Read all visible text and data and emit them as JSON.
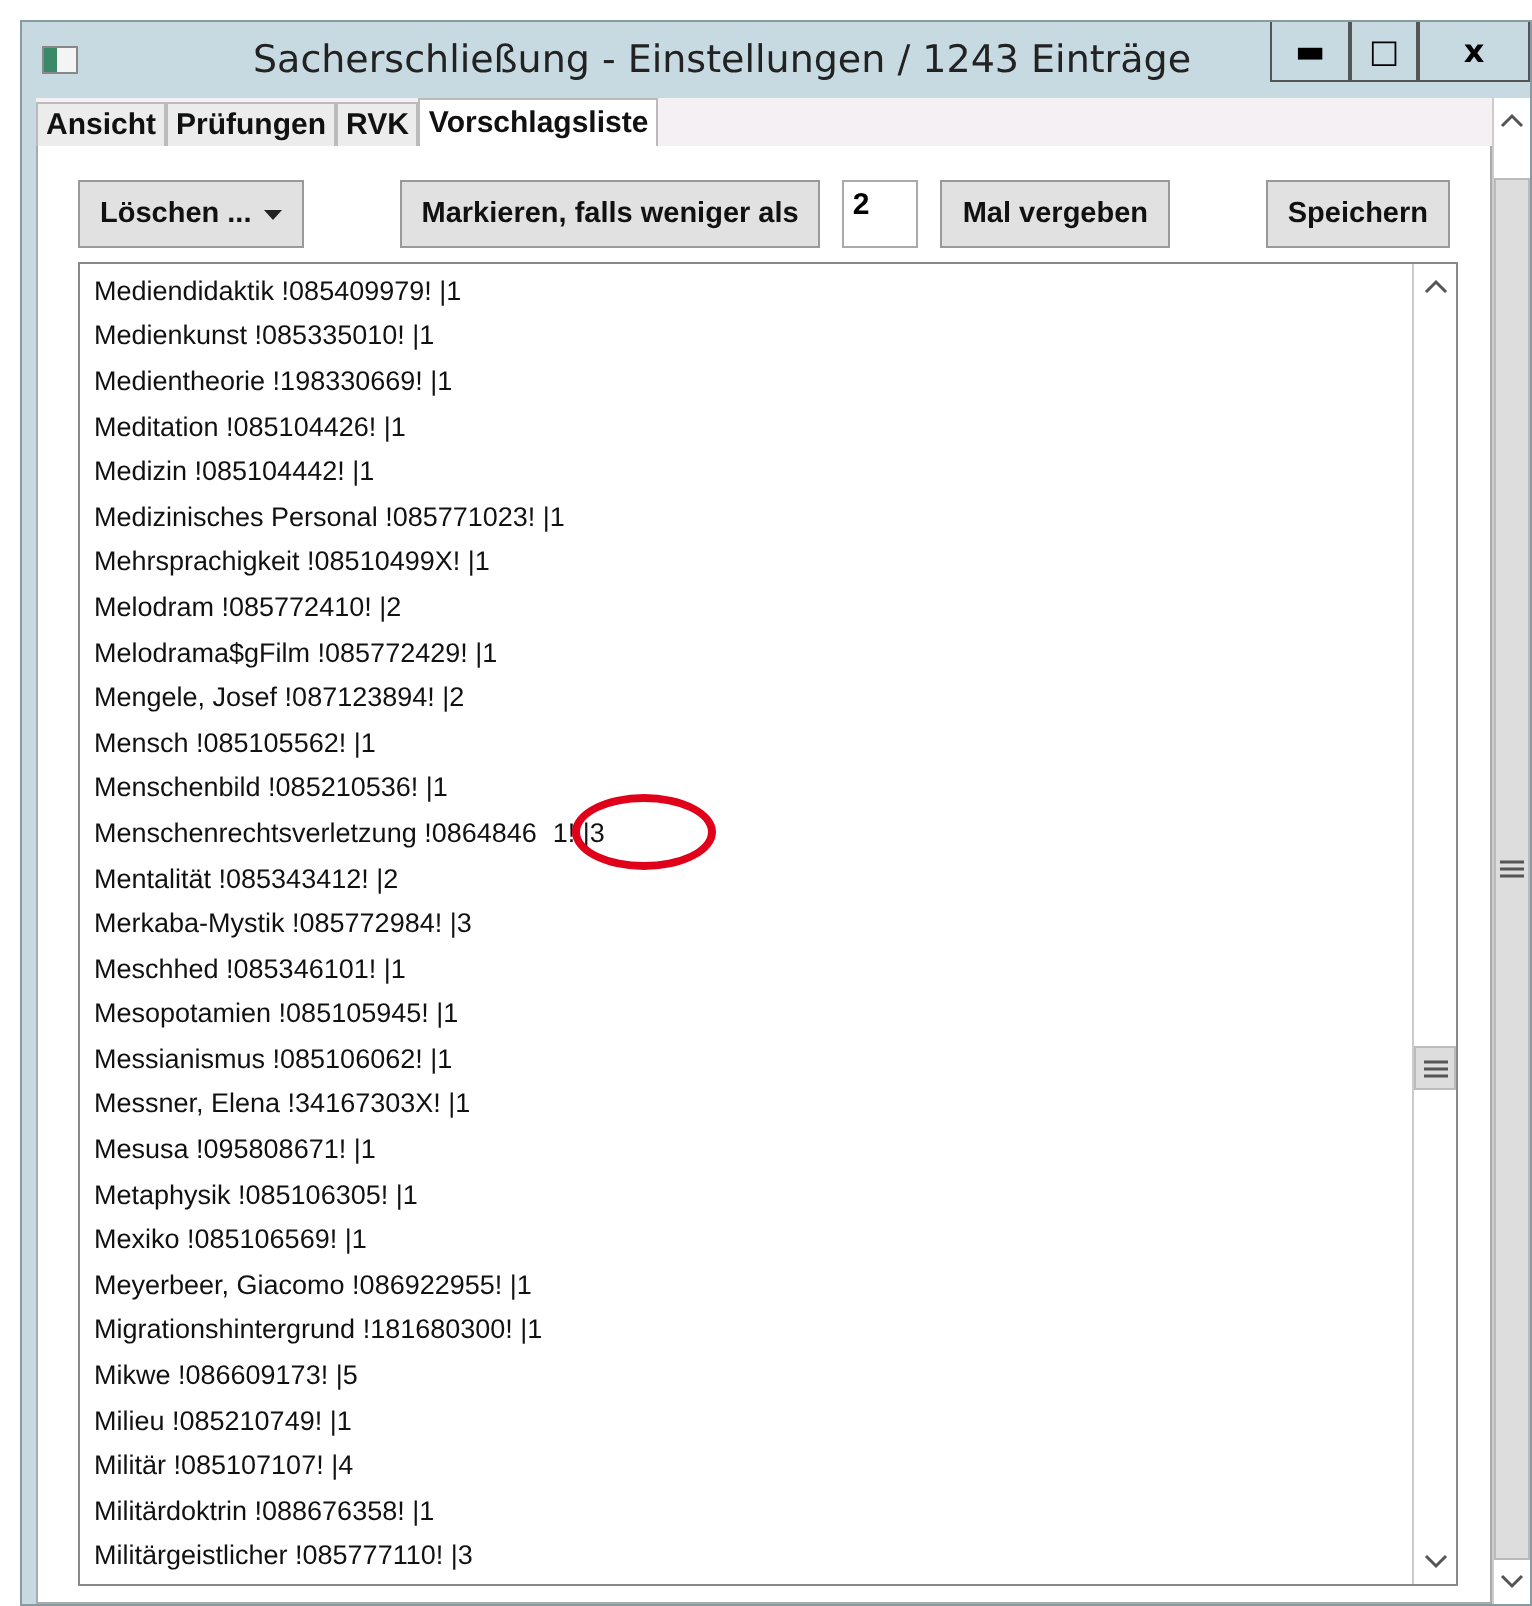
{
  "window": {
    "title": "Sacherschließung - Einstellungen / 1243 Einträge",
    "controls": [
      "▬",
      "□",
      "x"
    ]
  },
  "tabs": [
    {
      "label": "Ansicht",
      "selected": false
    },
    {
      "label": "Prüfungen",
      "selected": false
    },
    {
      "label": "RVK",
      "selected": false
    },
    {
      "label": "Vorschlagsliste",
      "selected": true
    }
  ],
  "toolbar": {
    "delete_menu": "Löschen ...",
    "mark_button": "Markieren, falls weniger als",
    "threshold": "2",
    "assign_button": "Mal vergeben",
    "save_button": "Speichern"
  },
  "list": {
    "items": [
      {
        "text": "Mediendidaktik !085409979! |1"
      },
      {
        "text": "Medienkunst !085335010! |1"
      },
      {
        "text": "Medientheorie !198330669! |1"
      },
      {
        "text": "Meditation !085104426! |1"
      },
      {
        "text": "Medizin !085104442! |1"
      },
      {
        "text": "Medizinisches Personal !085771023! |1"
      },
      {
        "text": "Mehrsprachigkeit !08510499X! |1"
      },
      {
        "text": "Melodram !085772410! |2"
      },
      {
        "text": "Melodrama$gFilm !085772429! |1"
      },
      {
        "text": "Mengele, Josef !087123894! |2"
      },
      {
        "text": "Mensch !085105562! |1"
      },
      {
        "text": "Menschenbild !085210536! |1"
      },
      {
        "text": "Menschenrechtsverletzung !0864846",
        "tail": "1! |3",
        "circled": true
      },
      {
        "text": "Mentalität !085343412! |2"
      },
      {
        "text": "Merkaba-Mystik !085772984! |3"
      },
      {
        "text": "Meschhed !085346101! |1"
      },
      {
        "text": "Mesopotamien !085105945! |1"
      },
      {
        "text": "Messianismus !085106062! |1"
      },
      {
        "text": "Messner, Elena !34167303X! |1"
      },
      {
        "text": "Mesusa !095808671! |1"
      },
      {
        "text": "Metaphysik !085106305! |1"
      },
      {
        "text": "Mexiko !085106569! |1"
      },
      {
        "text": "Meyerbeer, Giacomo !086922955! |1"
      },
      {
        "text": "Migrationshintergrund !181680300! |1"
      },
      {
        "text": "Mikwe !086609173! |5"
      },
      {
        "text": "Milieu !085210749! |1"
      },
      {
        "text": "Militär !085107107! |4"
      },
      {
        "text": "Militärdoktrin !088676358! |1"
      },
      {
        "text": "Militärgeistlicher !085777110! |3"
      }
    ]
  }
}
